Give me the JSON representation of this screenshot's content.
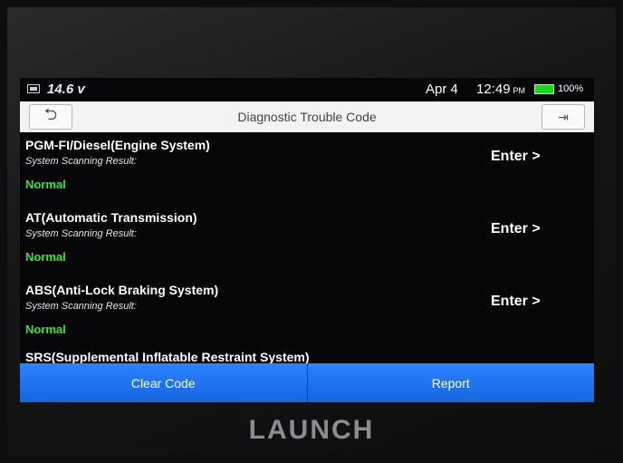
{
  "status_bar": {
    "voltage": "14.6 v",
    "date": "Apr 4",
    "time": "12:49",
    "time_ampm": "PM",
    "battery_percent": "100%",
    "battery_color": "#1fd21f"
  },
  "header": {
    "title": "Diagnostic Trouble Code",
    "back_icon": "back-arrow-icon",
    "exit_icon": "exit-icon"
  },
  "systems": [
    {
      "name": "PGM-FI/Diesel(Engine System)",
      "subtitle": "System Scanning Result:",
      "result": "Normal",
      "action": "Enter"
    },
    {
      "name": "AT(Automatic Transmission)",
      "subtitle": "System Scanning Result:",
      "result": "Normal",
      "action": "Enter"
    },
    {
      "name": "ABS(Anti-Lock Braking System)",
      "subtitle": "System Scanning Result:",
      "result": "Normal",
      "action": "Enter"
    }
  ],
  "partial_item": "SRS(Supplemental Inflatable Restraint System)",
  "buttons": {
    "clear_code": "Clear Code",
    "report": "Report"
  },
  "colors": {
    "accent": "#1f74f0",
    "result_normal": "#3ee03e"
  },
  "brand": "LAUNCH"
}
